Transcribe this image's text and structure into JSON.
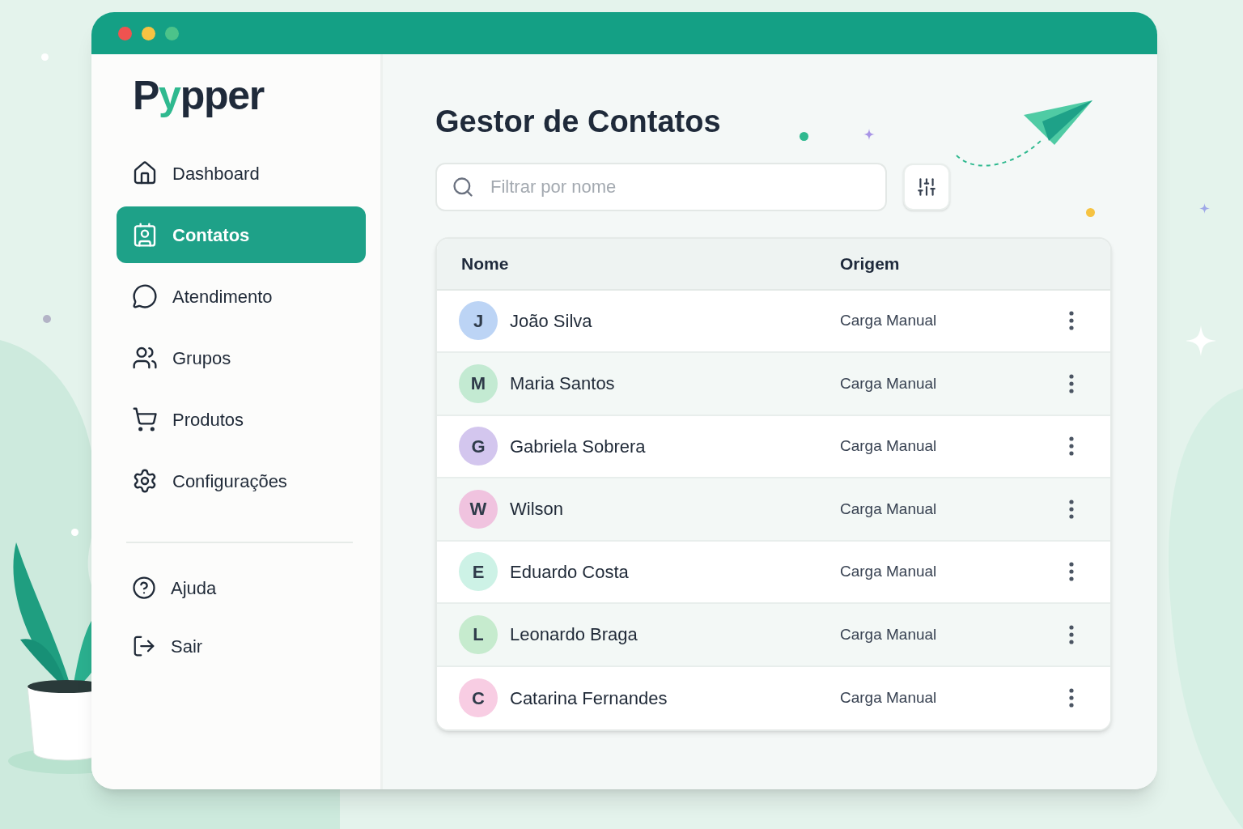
{
  "window": {
    "controls": [
      {
        "color": "#ef5350"
      },
      {
        "color": "#f6c342"
      },
      {
        "color": "#4cc38a"
      }
    ]
  },
  "sidebar": {
    "logo_parts": [
      {
        "text": "P",
        "accent": false
      },
      {
        "text": "y",
        "accent": true
      },
      {
        "text": "pper",
        "accent": false
      }
    ],
    "items": [
      {
        "label": "Dashboard",
        "selected": false
      },
      {
        "label": "Contatos",
        "selected": true
      },
      {
        "label": "Atendimento",
        "selected": false
      },
      {
        "label": "Grupos",
        "selected": false
      },
      {
        "label": "Produtos",
        "selected": false
      },
      {
        "label": "Configurações",
        "selected": false
      }
    ],
    "footer_items": [
      {
        "label": "Ajuda"
      },
      {
        "label": "Sair"
      }
    ]
  },
  "page_title": "Gestor de Contatos",
  "search": {
    "placeholder": "Filtrar por nome"
  },
  "table": {
    "columns": [
      "Nome",
      "Origem"
    ],
    "rows": [
      {
        "initial": "J",
        "name": "João Silva",
        "origem": "Carga Manual",
        "color": "#bcd4f5"
      },
      {
        "initial": "M",
        "name": "Maria Santos",
        "origem": "Carga Manual",
        "color": "#c3ead2"
      },
      {
        "initial": "G",
        "name": "Gabriela Sobrera",
        "origem": "Carga Manual",
        "color": "#d3c6ee"
      },
      {
        "initial": "W",
        "name": "Wilson",
        "origem": "Carga Manual",
        "color": "#f0c3df"
      },
      {
        "initial": "E",
        "name": "Eduardo Costa",
        "origem": "Carga Manual",
        "color": "#cdf2e6"
      },
      {
        "initial": "L",
        "name": "Leonardo Braga",
        "origem": "Carga Manual",
        "color": "#c6ebce"
      },
      {
        "initial": "C",
        "name": "Catarina Fernandes",
        "origem": "Carga Manual",
        "color": "#f8cde3"
      }
    ]
  }
}
